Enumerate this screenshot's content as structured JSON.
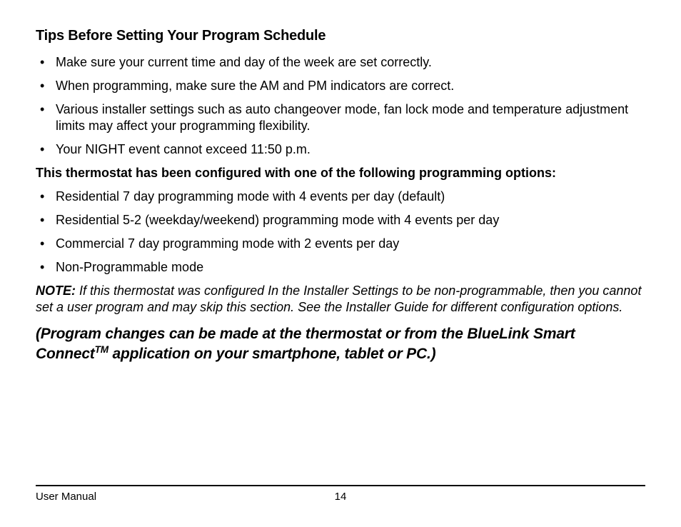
{
  "heading": "Tips Before Setting Your Program Schedule",
  "tips": [
    "Make sure your current time and day of the week are set correctly.",
    "When programming, make sure the AM and PM indicators are correct.",
    "Various installer settings such as auto changeover mode, fan lock mode and temperature adjustment limits may affect your programming flexibility.",
    "Your NIGHT event cannot exceed 11:50 p.m."
  ],
  "subheading": "This thermostat has been configured with one of the following programming options:",
  "options": [
    "Residential 7 day programming mode with 4 events per day (default)",
    "Residential 5-2 (weekday/weekend) programming mode with 4 events per day",
    "Commercial 7 day programming mode with 2 events per day",
    "Non-Programmable mode"
  ],
  "note_label": "NOTE:",
  "note_text": " If this thermostat was configured In the Installer Settings to be non-programmable, then you cannot set a user program and may skip this section. See the Installer Guide for different configuration options.",
  "callout_part1": "(Program changes can be made at the thermostat or from the BlueLink Smart Connect",
  "callout_tm": "TM",
  "callout_part2": " application on your smartphone, tablet or PC.)",
  "footer_left": "User Manual",
  "footer_page": "14"
}
